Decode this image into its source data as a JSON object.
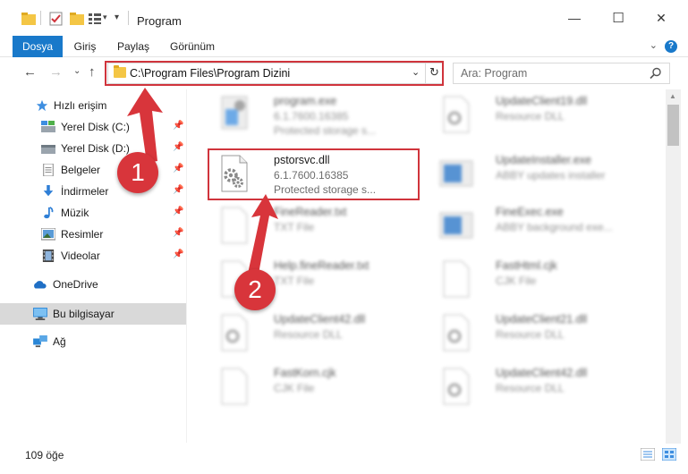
{
  "window": {
    "title": "Program",
    "controls": {
      "minimize": "—",
      "maximize": "☐",
      "close": "✕"
    }
  },
  "ribbon": {
    "tabs": [
      {
        "label": "Dosya",
        "active": true
      },
      {
        "label": "Giriş",
        "active": false
      },
      {
        "label": "Paylaş",
        "active": false
      },
      {
        "label": "Görünüm",
        "active": false
      }
    ],
    "expand_icon": "chevron-down-icon",
    "help_label": "?"
  },
  "navigation": {
    "back_icon": "arrow-left-icon",
    "forward_icon": "arrow-right-icon",
    "recent_icon": "chevron-down-icon",
    "up_icon": "arrow-up-icon",
    "address": "C:\\Program Files\\Program Dizini",
    "search_placeholder": "Ara: Program"
  },
  "sidebar": {
    "items": [
      {
        "label": "Hızlı erişim",
        "icon": "star-icon",
        "pinned": false
      },
      {
        "label": "Yerel Disk (C:)",
        "icon": "drive-icon",
        "pinned": true
      },
      {
        "label": "Yerel Disk (D:)",
        "icon": "drive-icon",
        "pinned": true
      },
      {
        "label": "Belgeler",
        "icon": "document-icon",
        "pinned": true
      },
      {
        "label": "İndirmeler",
        "icon": "download-icon",
        "pinned": true
      },
      {
        "label": "Müzik",
        "icon": "music-icon",
        "pinned": true
      },
      {
        "label": "Resimler",
        "icon": "picture-icon",
        "pinned": true
      },
      {
        "label": "Videolar",
        "icon": "video-icon",
        "pinned": true
      },
      {
        "label": "OneDrive",
        "icon": "cloud-icon",
        "pinned": false
      },
      {
        "label": "Bu bilgisayar",
        "icon": "computer-icon",
        "pinned": false,
        "selected": true
      },
      {
        "label": "Ağ",
        "icon": "network-icon",
        "pinned": false
      }
    ]
  },
  "files": [
    {
      "name": "program.exe",
      "line1": "6.1.7600.16385",
      "line2": "Protected storage s...",
      "icon": "exe-icon",
      "blurred": true
    },
    {
      "name": "UpdateClient19.dll",
      "line1": "Resource DLL",
      "line2": "",
      "icon": "dll-icon",
      "blurred": true
    },
    {
      "name": "pstorsvc.dll",
      "line1": "6.1.7600.16385",
      "line2": "Protected storage s...",
      "icon": "dll-gear-icon",
      "blurred": false
    },
    {
      "name": "UpdateInstaller.exe",
      "line1": "ABBY updates installer",
      "line2": "",
      "icon": "window-icon",
      "blurred": true
    },
    {
      "name": "FineReader.txt",
      "line1": "TXT File",
      "line2": "",
      "icon": "text-file-icon",
      "blurred": true
    },
    {
      "name": "FineExec.exe",
      "line1": "ABBY background exe...",
      "line2": "",
      "icon": "window-icon",
      "blurred": true
    },
    {
      "name": "Help.fineReader.txt",
      "line1": "TXT File",
      "line2": "",
      "icon": "text-file-icon",
      "blurred": true
    },
    {
      "name": "FastHtml.cjk",
      "line1": "CJK File",
      "line2": "",
      "icon": "file-icon",
      "blurred": true
    },
    {
      "name": "UpdateClient42.dll",
      "line1": "Resource DLL",
      "line2": "",
      "icon": "dll-icon",
      "blurred": true
    },
    {
      "name": "UpdateClient21.dll",
      "line1": "Resource DLL",
      "line2": "",
      "icon": "dll-icon",
      "blurred": true
    },
    {
      "name": "FastKorn.cjk",
      "line1": "CJK File",
      "line2": "",
      "icon": "file-icon",
      "blurred": true
    },
    {
      "name": "UpdateClient42.dll",
      "line1": "Resource DLL",
      "line2": "",
      "icon": "dll-icon",
      "blurred": true
    }
  ],
  "status": {
    "count": "109 öğe"
  },
  "annotations": {
    "badge_1": "1",
    "badge_2": "2"
  },
  "colors": {
    "accent": "#1979ca",
    "highlight": "#d0343c",
    "badge": "#d8353b",
    "selected": "#d9d9d9"
  }
}
